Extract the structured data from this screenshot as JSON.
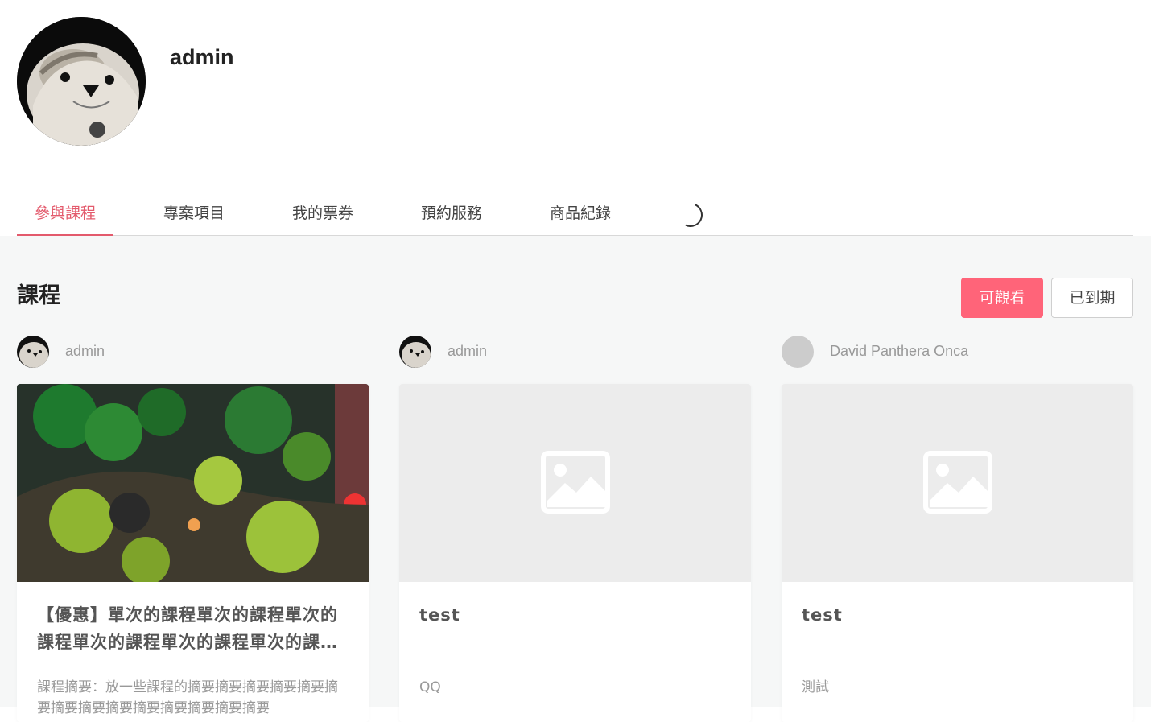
{
  "profile": {
    "username": "admin"
  },
  "tabs": [
    {
      "label": "參與課程",
      "active": true
    },
    {
      "label": "專案項目"
    },
    {
      "label": "我的票券"
    },
    {
      "label": "預約服務"
    },
    {
      "label": "商品紀錄"
    }
  ],
  "section": {
    "title": "課程"
  },
  "filters": {
    "available": "可觀看",
    "expired": "已到期"
  },
  "colors": {
    "accent": "#e35a6c",
    "button": "#ff6479"
  },
  "courses": [
    {
      "author": "admin",
      "title": "【優惠】單次的課程單次的課程單次的課程單次的課程單次的課程單次的課程單次的課程",
      "summary": "課程摘要：放一些課程的摘要摘要摘要摘要摘要摘要摘要摘要摘要摘要摘要摘要摘要摘要",
      "image": "terrarium-photo"
    },
    {
      "author": "admin",
      "title": "test",
      "summary": "QQ",
      "image": "image-placeholder-icon"
    },
    {
      "author": "David Panthera Onca",
      "title": "test",
      "summary": "測試",
      "image": "image-placeholder-icon"
    }
  ]
}
